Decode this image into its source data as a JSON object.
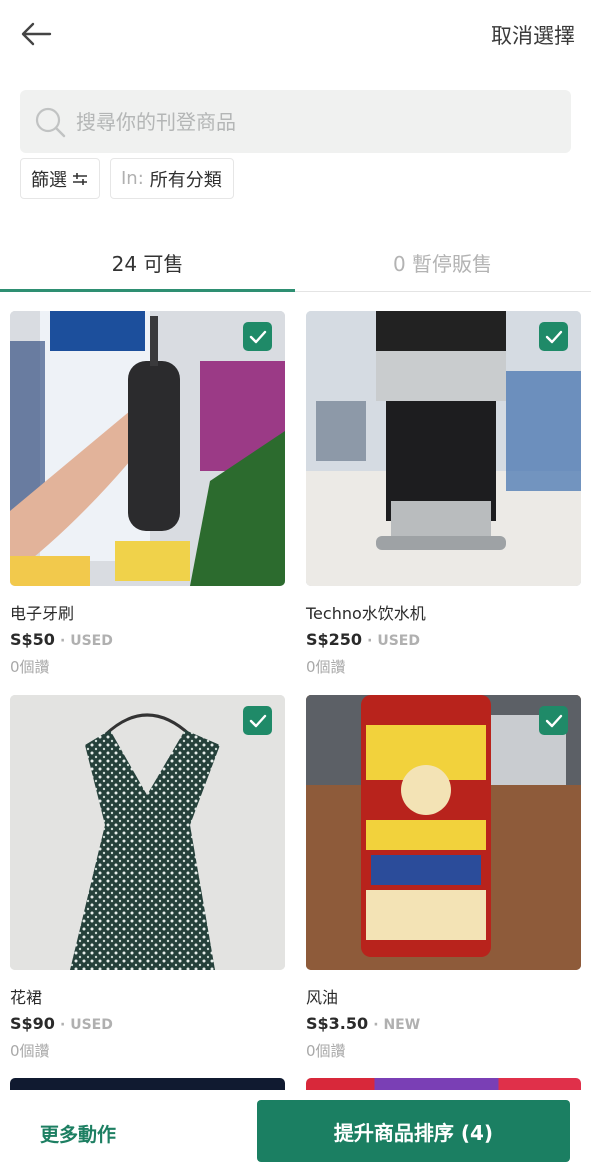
{
  "header": {
    "cancel_selection": "取消選擇"
  },
  "search": {
    "placeholder": "搜尋你的刊登商品"
  },
  "filters": {
    "filter_label": "篩選",
    "category_prefix": "In:",
    "category_value": "所有分類"
  },
  "tabs": [
    {
      "label": "24 可售",
      "active": true
    },
    {
      "label": "0 暫停販售",
      "active": false
    }
  ],
  "items": [
    {
      "title": "电子牙刷",
      "price": "S$50",
      "condition": "USED",
      "likes": "0個讚",
      "selected": true
    },
    {
      "title": "Techno水饮水机",
      "price": "S$250",
      "condition": "USED",
      "likes": "0個讚",
      "selected": true
    },
    {
      "title": "花裙",
      "price": "S$90",
      "condition": "USED",
      "likes": "0個讚",
      "selected": true
    },
    {
      "title": "风油",
      "price": "S$3.50",
      "condition": "NEW",
      "likes": "0個讚",
      "selected": true
    }
  ],
  "bottom": {
    "more_actions": "更多動作",
    "boost_label": "提升商品排序 (4)"
  },
  "colors": {
    "accent": "#1b7f62",
    "tab_underline": "#2e8f72"
  }
}
